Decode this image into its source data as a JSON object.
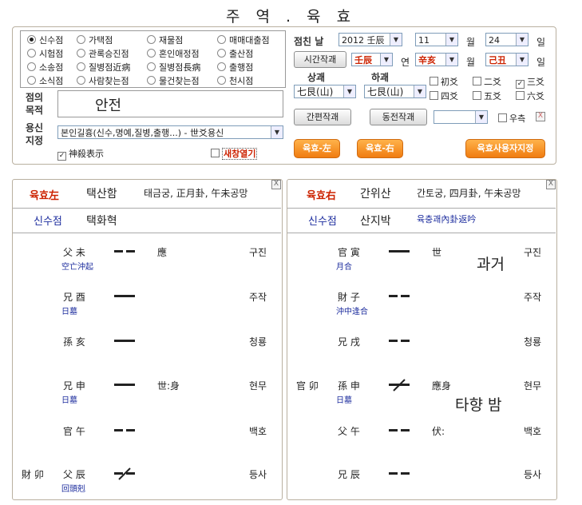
{
  "title": "주 역 . 육 효",
  "divinations": [
    {
      "label": "신수점",
      "checked": true
    },
    {
      "label": "가택점",
      "checked": false
    },
    {
      "label": "재물점",
      "checked": false
    },
    {
      "label": "매매대출점",
      "checked": false
    },
    {
      "label": "시험점",
      "checked": false
    },
    {
      "label": "관록승진점",
      "checked": false
    },
    {
      "label": "혼인애정점",
      "checked": false
    },
    {
      "label": "출산점",
      "checked": false
    },
    {
      "label": "소송점",
      "checked": false
    },
    {
      "label": "질병점近病",
      "checked": false
    },
    {
      "label": "질병점長病",
      "checked": false
    },
    {
      "label": "출행점",
      "checked": false
    },
    {
      "label": "소식점",
      "checked": false
    },
    {
      "label": "사람찾는점",
      "checked": false
    },
    {
      "label": "물건찾는점",
      "checked": false
    },
    {
      "label": "천시점",
      "checked": false
    }
  ],
  "purpose": {
    "label_line1": "점의",
    "label_line2": "목적",
    "value": "안전"
  },
  "yongsin": {
    "label_line1": "용신",
    "label_line2": "지정",
    "value": "본인길흉(신수,명예,질병,출행...) - 世爻용신"
  },
  "shinsal_checkbox": {
    "label": "神殺表示",
    "checked": true
  },
  "new_window_checkbox": {
    "label": "새창열기",
    "checked": false
  },
  "date": {
    "label": "점친 날",
    "year": "2012 壬辰",
    "month": "11",
    "month_unit": "월",
    "day": "24",
    "day_unit": "일"
  },
  "ganji": {
    "button": "시간작괘",
    "year": "壬辰",
    "year_unit": "연",
    "month": "辛亥",
    "month_unit": "월",
    "day": "己丑",
    "day_unit": "일"
  },
  "trigrams": {
    "upper_label": "상괘",
    "lower_label": "하괘",
    "upper": "七艮(山)",
    "lower": "七艮(山)"
  },
  "lines_checks": [
    {
      "label": "初爻",
      "checked": false
    },
    {
      "label": "二爻",
      "checked": false
    },
    {
      "label": "三爻",
      "checked": true
    },
    {
      "label": "四爻",
      "checked": false
    },
    {
      "label": "五爻",
      "checked": false
    },
    {
      "label": "六爻",
      "checked": false
    }
  ],
  "buttons": {
    "simple": "간편작괘",
    "coin": "동전작괘",
    "coin_select": "",
    "right_side": "우측",
    "left": "육효-左",
    "right": "육효-右",
    "user": "육효사용자지정"
  },
  "left_panel": {
    "tag": "육효左",
    "gua": "택산함",
    "info": "태금궁, 正月卦, 午未공망",
    "sub_tag": "신수점",
    "changed_gua": "택화혁",
    "lines": [
      {
        "side": "",
        "name": "父 未",
        "note": "空亡沖起",
        "yao": "yin",
        "shi": "應",
        "god": "구진"
      },
      {
        "side": "",
        "name": "兄 酉",
        "note": "日墓",
        "yao": "yang",
        "shi": "",
        "god": "주작"
      },
      {
        "side": "",
        "name": "孫 亥",
        "note": "",
        "yao": "yang",
        "shi": "",
        "god": "청룡"
      },
      {
        "side": "",
        "name": "兄 申",
        "note": "日墓",
        "yao": "yang",
        "shi": "世:身",
        "god": "현무"
      },
      {
        "side": "",
        "name": "官 午",
        "note": "",
        "yao": "yin",
        "shi": "",
        "god": "백호"
      },
      {
        "side": "財 卯",
        "name": "父 辰",
        "note": "回頭剋",
        "yao": "yin-moving",
        "shi": "",
        "god": "등사"
      }
    ]
  },
  "right_panel": {
    "tag": "육효右",
    "gua": "간위산",
    "info": "간토궁, 四月卦, 午未공망",
    "sub_tag": "신수점",
    "changed_gua": "산지박",
    "changed_note": "육충괘內卦返吟",
    "handwriting_1": "과거",
    "handwriting_2": "타향 밤",
    "lines": [
      {
        "side": "",
        "name": "官 寅",
        "note": "月合",
        "yao": "yang",
        "shi": "世",
        "god": "구진"
      },
      {
        "side": "",
        "name": "財 子",
        "note": "沖中逢合",
        "yao": "yin",
        "shi": "",
        "god": "주작"
      },
      {
        "side": "",
        "name": "兄 戌",
        "note": "",
        "yao": "yin",
        "shi": "",
        "god": "청룡"
      },
      {
        "side": "官 卯",
        "name": "孫 申",
        "note": "日墓",
        "yao": "yang-moving",
        "shi": "應身",
        "god": "현무"
      },
      {
        "side": "",
        "name": "父 午",
        "note": "",
        "yao": "yin",
        "shi": "伏:",
        "god": "백호"
      },
      {
        "side": "",
        "name": "兄 辰",
        "note": "",
        "yao": "yin",
        "shi": "",
        "god": "등사"
      }
    ]
  },
  "colors": {
    "accent": "#f07c10",
    "red": "#cc2200",
    "blue": "#1d2d9e"
  }
}
